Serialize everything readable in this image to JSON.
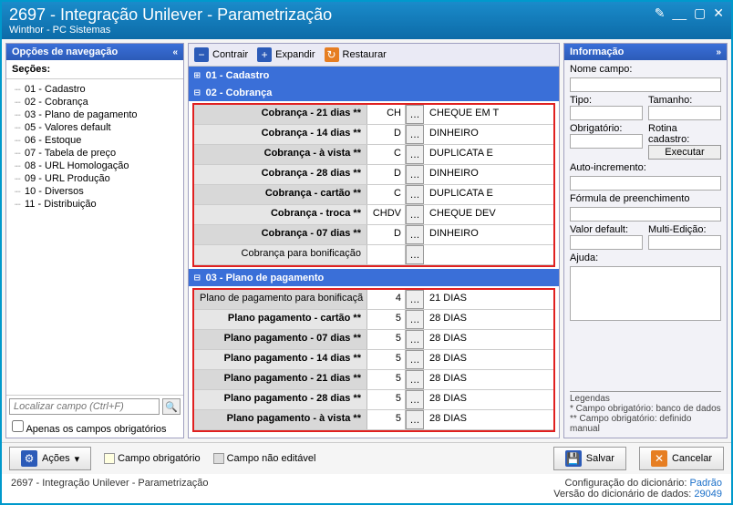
{
  "titlebar": {
    "main": "2697 - Integração Unilever - Parametrização",
    "sub": "Winthor - PC Sistemas"
  },
  "nav": {
    "header": "Opções de navegação",
    "sections_label": "Seções:",
    "items": [
      "01 - Cadastro",
      "02 - Cobrança",
      "03 - Plano de pagamento",
      "05 - Valores default",
      "06 - Estoque",
      "07 - Tabela de preço",
      "08 - URL Homologação",
      "09 - URL Produção",
      "10 - Diversos",
      "11 - Distribuição"
    ],
    "search_placeholder": "Localizar campo (Ctrl+F)",
    "only_required": "Apenas os campos obrigatórios"
  },
  "toolbar": {
    "contrair": "Contrair",
    "expandir": "Expandir",
    "restaurar": "Restaurar"
  },
  "sections": [
    {
      "id": "01",
      "title": "01 - Cadastro",
      "expanded": false,
      "rows": []
    },
    {
      "id": "02",
      "title": "02 - Cobrança",
      "expanded": true,
      "rows": [
        {
          "label": "Cobrança - 21 dias **",
          "bold": true,
          "code": "CH",
          "val": "CHEQUE EM T"
        },
        {
          "label": "Cobrança - 14 dias **",
          "bold": true,
          "code": "D",
          "val": "DINHEIRO"
        },
        {
          "label": "Cobrança - à vista **",
          "bold": true,
          "code": "C",
          "val": "DUPLICATA E"
        },
        {
          "label": "Cobrança - 28 dias **",
          "bold": true,
          "code": "D",
          "val": "DINHEIRO"
        },
        {
          "label": "Cobrança - cartão **",
          "bold": true,
          "code": "C",
          "val": "DUPLICATA E"
        },
        {
          "label": "Cobrança - troca **",
          "bold": true,
          "code": "CHDV",
          "val": "CHEQUE DEV"
        },
        {
          "label": "Cobrança - 07 dias **",
          "bold": true,
          "code": "D",
          "val": "DINHEIRO"
        },
        {
          "label": "Cobrança para bonificação",
          "bold": false,
          "code": "",
          "val": ""
        }
      ]
    },
    {
      "id": "03",
      "title": "03 - Plano de pagamento",
      "expanded": true,
      "rows": [
        {
          "label": "Plano de pagamento para bonificaçã",
          "bold": false,
          "code": "4",
          "val": "21 DIAS"
        },
        {
          "label": "Plano pagamento - cartão **",
          "bold": true,
          "code": "5",
          "val": "28 DIAS"
        },
        {
          "label": "Plano pagamento - 07 dias **",
          "bold": true,
          "code": "5",
          "val": "28 DIAS"
        },
        {
          "label": "Plano pagamento - 14 dias **",
          "bold": true,
          "code": "5",
          "val": "28 DIAS"
        },
        {
          "label": "Plano pagamento - 21 dias **",
          "bold": true,
          "code": "5",
          "val": "28 DIAS"
        },
        {
          "label": "Plano pagamento - 28 dias **",
          "bold": true,
          "code": "5",
          "val": "28 DIAS"
        },
        {
          "label": "Plano pagamento - à vista **",
          "bold": true,
          "code": "5",
          "val": "28 DIAS"
        }
      ]
    }
  ],
  "info": {
    "header": "Informação",
    "nome": "Nome campo:",
    "tipo": "Tipo:",
    "tamanho": "Tamanho:",
    "obrig": "Obrigatório:",
    "rotina": "Rotina cadastro:",
    "exec": "Executar",
    "auto": "Auto-incremento:",
    "formula": "Fórmula de preenchimento",
    "valdef": "Valor default:",
    "multi": "Multi-Edição:",
    "ajuda": "Ajuda:",
    "legendas": "Legendas",
    "leg1": "* Campo obrigatório: banco de dados",
    "leg2": "** Campo obrigatório: definido manual"
  },
  "bottom": {
    "acoes": "Ações",
    "leg_obrig": "Campo obrigatório",
    "leg_naoedit": "Campo não editável",
    "salvar": "Salvar",
    "cancelar": "Cancelar"
  },
  "status": {
    "left": "2697 - Integração Unilever - Parametrização",
    "cfg_lbl": "Configuração do dicionário:",
    "cfg_val": "Padrão",
    "ver_lbl": "Versão do dicionário de dados:",
    "ver_val": "29049"
  }
}
